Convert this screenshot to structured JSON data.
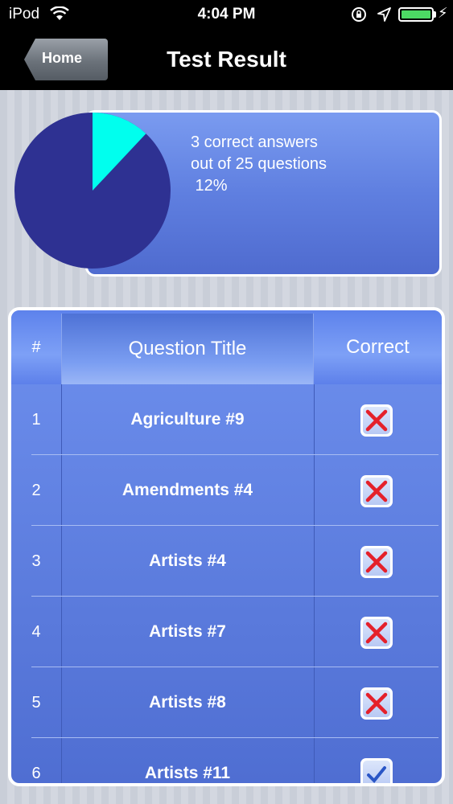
{
  "status_bar": {
    "carrier": "iPod",
    "time": "4:04 PM"
  },
  "nav": {
    "back_label": "Home",
    "title": "Test Result"
  },
  "summary": {
    "line1": "3 correct answers",
    "line2": "out of 25 questions",
    "line3": " 12%",
    "correct": 3,
    "total": 25,
    "percent": 12,
    "colors": {
      "correct": "#00ffee",
      "incorrect": "#2e3192"
    }
  },
  "table": {
    "headers": {
      "number": "#",
      "title": "Question Title",
      "correct": "Correct"
    },
    "rows": [
      {
        "number": "1",
        "title": "Agriculture #9",
        "result": "incorrect"
      },
      {
        "number": "2",
        "title": "Amendments #4",
        "result": "incorrect"
      },
      {
        "number": "3",
        "title": "Artists #4",
        "result": "incorrect"
      },
      {
        "number": "4",
        "title": "Artists #7",
        "result": "incorrect"
      },
      {
        "number": "5",
        "title": "Artists #8",
        "result": "incorrect"
      },
      {
        "number": "6",
        "title": "Artists #11",
        "result": "correct"
      }
    ]
  }
}
